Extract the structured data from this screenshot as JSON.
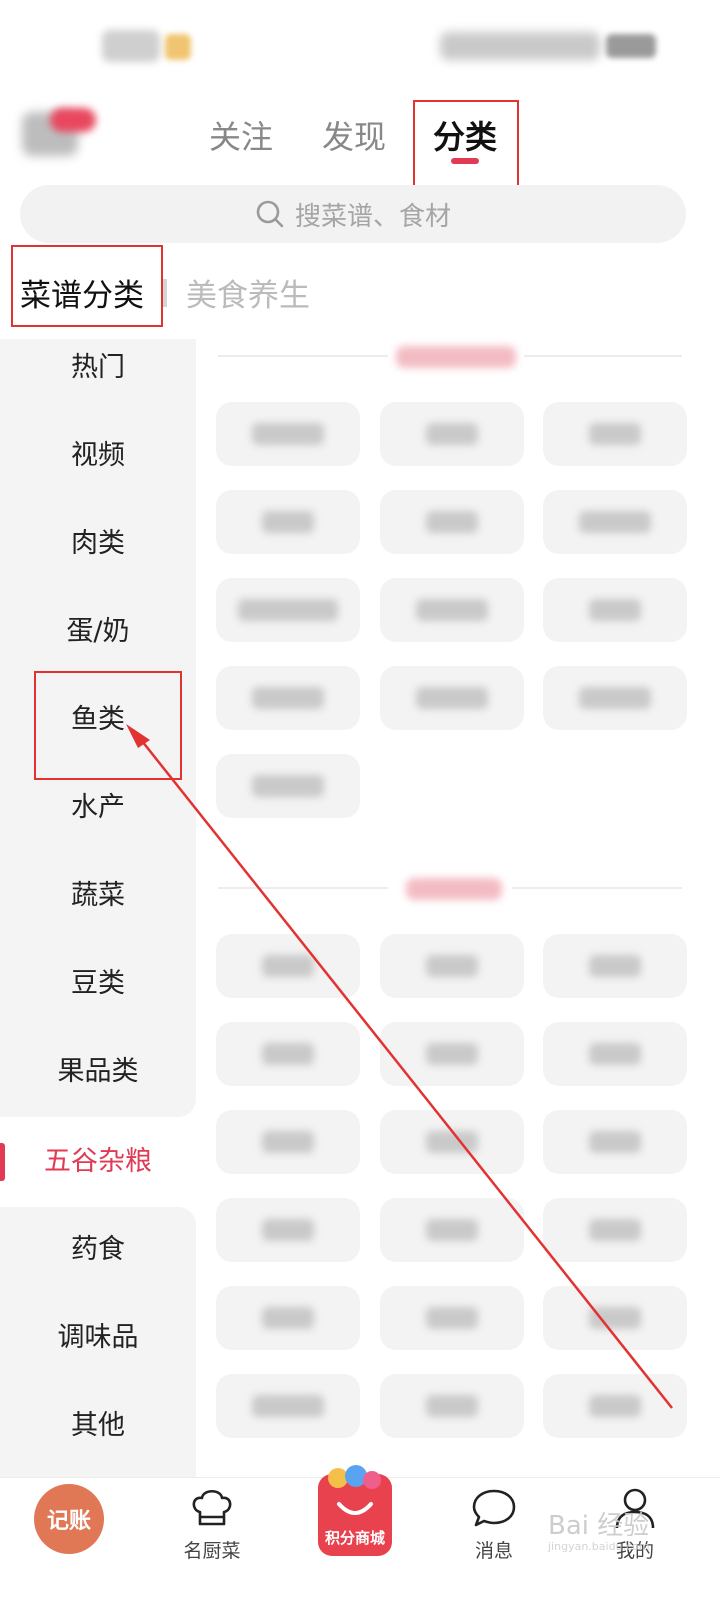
{
  "header": {
    "tabs": [
      {
        "label": "关注"
      },
      {
        "label": "发现"
      },
      {
        "label": "分类"
      }
    ]
  },
  "search": {
    "placeholder": "搜菜谱、食材"
  },
  "category_header": {
    "primary": "菜谱分类",
    "secondary": "美食养生"
  },
  "sidebar": {
    "items": [
      {
        "label": "热门"
      },
      {
        "label": "视频"
      },
      {
        "label": "肉类"
      },
      {
        "label": "蛋/奶"
      },
      {
        "label": "鱼类"
      },
      {
        "label": "水产"
      },
      {
        "label": "蔬菜"
      },
      {
        "label": "豆类"
      },
      {
        "label": "果品类"
      },
      {
        "label": "五谷杂粮"
      },
      {
        "label": "药食"
      },
      {
        "label": "调味品"
      },
      {
        "label": "其他"
      }
    ]
  },
  "bottom_nav": {
    "ledger": "记账",
    "chef": "名厨菜",
    "shop": "积分商城",
    "messages": "消息",
    "mine": "我的"
  },
  "watermark": {
    "brand": "Bai 经验",
    "url": "jingyan.baidu.com"
  },
  "colors": {
    "accent": "#e03a55",
    "annotation": "#e23232",
    "ledger": "#e07856"
  }
}
